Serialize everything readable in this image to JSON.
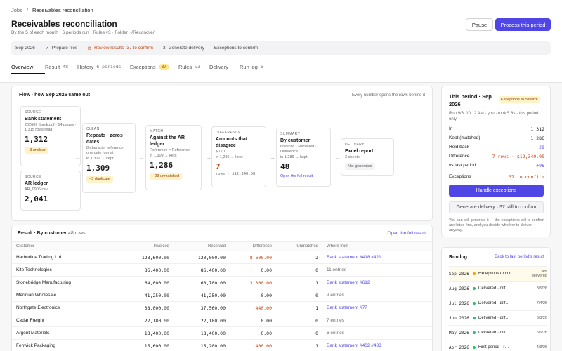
{
  "breadcrumb": {
    "root": "Jobs",
    "sep": "/",
    "current": "Receivables reconciliation"
  },
  "title": "Receivables reconciliation",
  "subtitle": "By the 5 of each month · 6 periods run · Rules v3 · Folder ~/Reconcile/",
  "actions": {
    "pause": "Pause",
    "process": "Process this period"
  },
  "stepper": {
    "period": "Sep 2026",
    "prepare": "Prepare files",
    "review": "Review results",
    "review_count": "37 to confirm",
    "generate_num": "3",
    "generate": "Generate delivery",
    "exceptions": "Exceptions to confirm"
  },
  "tabs": [
    {
      "label": "Overview",
      "count": ""
    },
    {
      "label": "Result",
      "count": "48"
    },
    {
      "label": "History",
      "count": "6 periods"
    },
    {
      "label": "Exceptions",
      "count": "37"
    },
    {
      "label": "Rules",
      "count": "v3"
    },
    {
      "label": "Delivery",
      "count": ""
    },
    {
      "label": "Run log",
      "count": "6"
    }
  ],
  "flow": {
    "title": "Flow · how Sep 2026 came out",
    "hint": "Every number opens the rows behind it",
    "source1": {
      "lbl": "Source",
      "name": "Bank statement",
      "meta": "202609_bank.pdf · 14 pages · 1,315 rows read",
      "value": "1,312",
      "tag": "−3 unclear"
    },
    "source2": {
      "lbl": "Source",
      "name": "AR ledger",
      "meta": "AR_0906.csv",
      "value": "2,041"
    },
    "clean": {
      "lbl": "Clean",
      "name": "Repeats · zeros · dates",
      "meta": "8-character reference; one date format",
      "flow": "in 1,312 → kept",
      "value": "1,309",
      "tag": "−3 duplicate"
    },
    "match": {
      "lbl": "Match",
      "name": "Against the AR ledger",
      "meta": "Reference = Reference",
      "flow": "in 1,309 → kept",
      "value": "1,286",
      "tag": "−23 unmatched"
    },
    "diff": {
      "lbl": "Difference",
      "name": "Amounts that disagree",
      "meta": "$0.01",
      "flow": "in 1,286 → kept",
      "value": "7",
      "extra": "rows · $12,340.00"
    },
    "summary": {
      "lbl": "Summary",
      "name": "By customer",
      "meta": "Invoiced · Received · Difference",
      "flow": "in 1,286 → kept",
      "value": "48",
      "link": "Open the full result"
    },
    "delivery": {
      "lbl": "Delivery",
      "name": "Excel report",
      "meta": "3 sheets",
      "tag": "Not generated"
    }
  },
  "result": {
    "title": "Result · By customer",
    "count": "48 rows",
    "link": "Open the full result",
    "columns": [
      "Customer",
      "Invoiced",
      "Received",
      "Difference",
      "Unmatched",
      "Where from"
    ],
    "rows": [
      {
        "customer": "Harborline Trading Ltd",
        "invoiced": "128,600.00",
        "received": "120,000.00",
        "diff": "8,600.00",
        "unmatched": "2",
        "from": "Bank statement #418 #421",
        "diffwarn": true,
        "fromlink": true
      },
      {
        "customer": "Kite Technologies",
        "invoiced": "86,400.00",
        "received": "86,400.00",
        "diff": "0.00",
        "unmatched": "0",
        "from": "11 entries",
        "diffwarn": false,
        "fromlink": false
      },
      {
        "customer": "Stonebridge Manufacturing",
        "invoiced": "64,000.00",
        "received": "60,700.00",
        "diff": "3,300.00",
        "unmatched": "1",
        "from": "Bank statement #612",
        "diffwarn": true,
        "fromlink": true
      },
      {
        "customer": "Meridian Wholesale",
        "invoiced": "41,250.00",
        "received": "41,250.00",
        "diff": "0.00",
        "unmatched": "0",
        "from": "9 entries",
        "diffwarn": false,
        "fromlink": false
      },
      {
        "customer": "Northgate Electronics",
        "invoiced": "38,000.00",
        "received": "37,560.00",
        "diff": "440.00",
        "unmatched": "1",
        "from": "Bank statement #77",
        "diffwarn": true,
        "fromlink": true
      },
      {
        "customer": "Cedar Freight",
        "invoiced": "22,180.00",
        "received": "22,180.00",
        "diff": "0.00",
        "unmatched": "0",
        "from": "7 entries",
        "diffwarn": false,
        "fromlink": false
      },
      {
        "customer": "Argent Materials",
        "invoiced": "18,400.00",
        "received": "18,400.00",
        "diff": "0.00",
        "unmatched": "0",
        "from": "6 entries",
        "diffwarn": false,
        "fromlink": false
      },
      {
        "customer": "Fenwick Packaging",
        "invoiced": "15,600.00",
        "received": "15,200.00",
        "diff": "400.00",
        "unmatched": "1",
        "from": "Bank statement #402 #433",
        "diffwarn": true,
        "fromlink": true
      }
    ]
  },
  "period": {
    "title": "This period · Sep 2026",
    "badge": "Exceptions to confirm",
    "run": "Run 9/6, 10:12 AM · you · took 5.8s · this period only",
    "stats": [
      {
        "k": "In",
        "v": "1,312",
        "c": "#1a1a1a"
      },
      {
        "k": "Kept (matched)",
        "v": "1,286",
        "c": "#1a1a1a"
      },
      {
        "k": "Held back",
        "v": "29",
        "c": "#4f46e5"
      },
      {
        "k": "Difference",
        "v": "7 rows · $12,340.00",
        "c": "#c2410c"
      },
      {
        "k": "vs last period",
        "v": "+96",
        "c": "#4f46e5"
      },
      {
        "k": "Exceptions",
        "v": "37 to confirm",
        "c": "#c2410c"
      }
    ],
    "handle": "Handle exceptions",
    "generate": "Generate delivery · 37 still to confirm",
    "note": "You can still generate it — the exceptions still to confirm are listed first, and you decide whether to deliver anyway."
  },
  "runlog": {
    "title": "Run log",
    "link": "Back to last period's result",
    "rows": [
      {
        "period": "Sep 2026",
        "status": "Exceptions to con…",
        "date": "Not delivered",
        "color": "#f59e0b",
        "hl": true
      },
      {
        "period": "Aug 2026",
        "status": "Delivered · diff…",
        "date": "8/5/26",
        "color": "#22c55e",
        "hl": false
      },
      {
        "period": "Jul 2026",
        "status": "Delivered · diff…",
        "date": "7/4/26",
        "color": "#22c55e",
        "hl": false
      },
      {
        "period": "Jun 2026",
        "status": "Delivered · diff…",
        "date": "6/5/26",
        "color": "#22c55e",
        "hl": false
      },
      {
        "period": "May 2026",
        "status": "Delivered · diff…",
        "date": "5/6/26",
        "color": "#22c55e",
        "hl": false
      },
      {
        "period": "Apr 2026",
        "status": "First period · r…",
        "date": "4/3/26",
        "color": "#22c55e",
        "hl": false
      }
    ]
  }
}
